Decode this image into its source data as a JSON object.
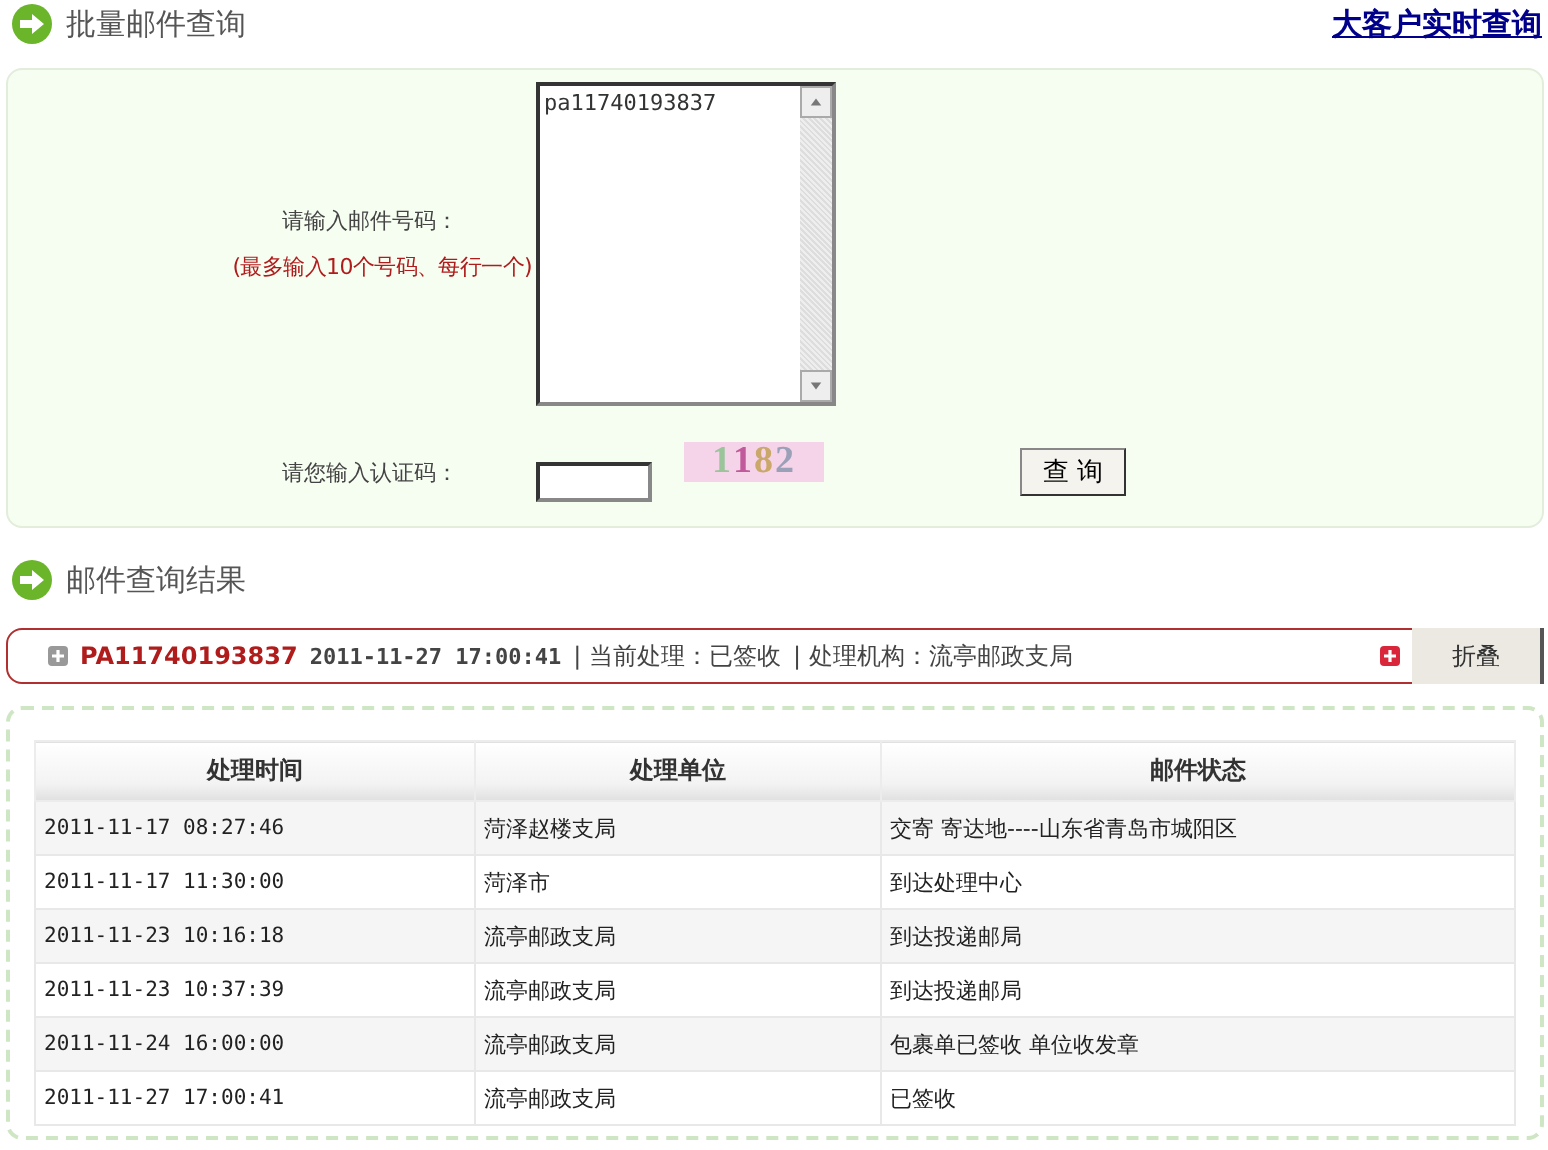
{
  "query_section": {
    "title": "批量邮件查询",
    "link": "大客户实时查询"
  },
  "form": {
    "number_label": "请输入邮件号码：",
    "number_hint": "(最多输入10个号码、每行一个)",
    "numbers_value": "pa11740193837",
    "code_label": "请您输入认证码：",
    "captcha": "1182",
    "submit": "查 询"
  },
  "result_section": {
    "title": "邮件查询结果"
  },
  "result": {
    "number": "PA11740193837",
    "time": "2011-11-27  17:00:41",
    "current": "| 当前处理：已签收",
    "agency": "| 处理机构：流亭邮政支局",
    "toggle": "折叠"
  },
  "table": {
    "columns": [
      "处理时间",
      "处理单位",
      "邮件状态"
    ],
    "rows": [
      [
        "2011-11-17 08:27:46",
        "菏泽赵楼支局",
        "交寄 寄达地----山东省青岛市城阳区"
      ],
      [
        "2011-11-17 11:30:00",
        "菏泽市",
        "到达处理中心"
      ],
      [
        "2011-11-23 10:16:18",
        "流亭邮政支局",
        "到达投递邮局"
      ],
      [
        "2011-11-23 10:37:39",
        "流亭邮政支局",
        "到达投递邮局"
      ],
      [
        "2011-11-24 16:00:00",
        "流亭邮政支局",
        "包裹单已签收 单位收发章"
      ],
      [
        "2011-11-27 17:00:41",
        "流亭邮政支局",
        "已签收"
      ]
    ]
  }
}
